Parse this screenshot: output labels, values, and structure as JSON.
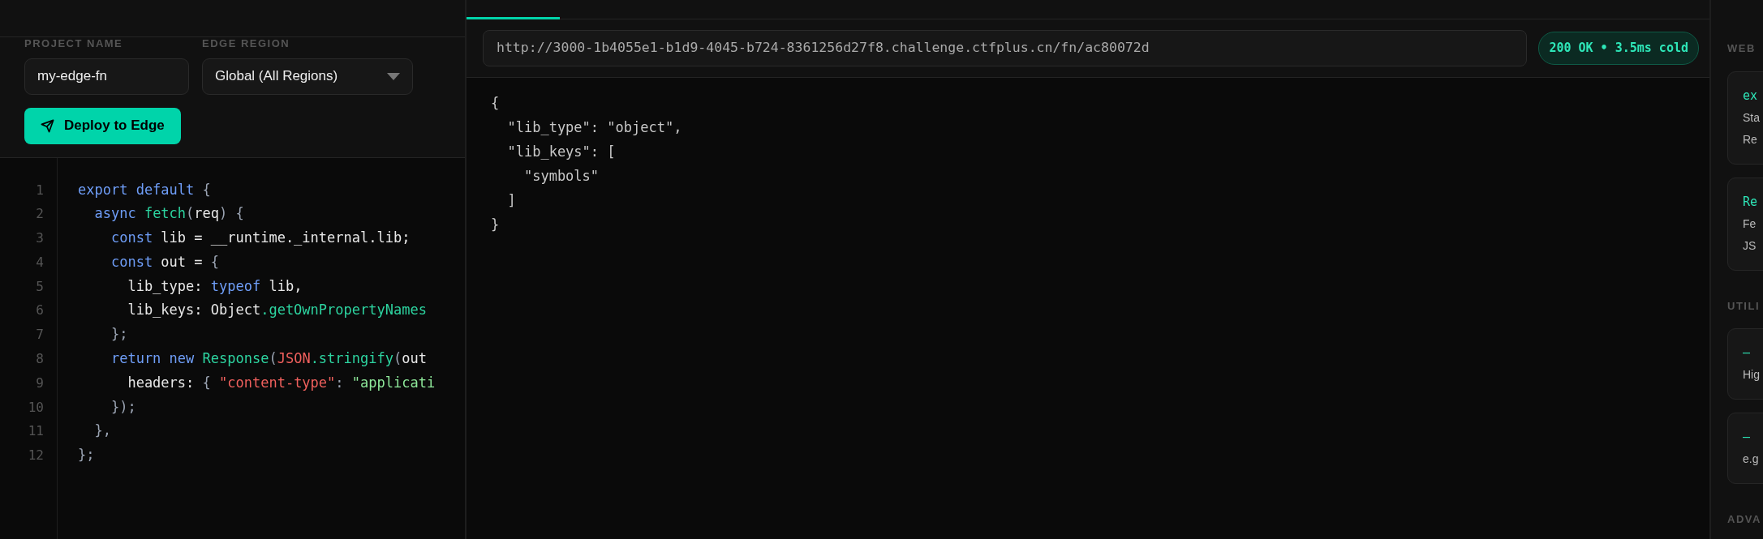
{
  "form": {
    "project_name": {
      "label": "PROJECT NAME",
      "value": "my-edge-fn"
    },
    "edge_region": {
      "label": "EDGE REGION",
      "value": "Global (All Regions)"
    },
    "deploy_button": "Deploy to Edge"
  },
  "code_lines": [
    {
      "number": "1",
      "tokens": [
        {
          "text": "export default",
          "kind": "keyword"
        },
        {
          "text": " {",
          "kind": "punct"
        }
      ]
    },
    {
      "number": "2",
      "tokens": [
        {
          "text": "  async",
          "kind": "keyword"
        },
        {
          "text": " fetch",
          "kind": "function"
        },
        {
          "text": "(",
          "kind": "punct"
        },
        {
          "text": "req",
          "kind": "plain"
        },
        {
          "text": ") {",
          "kind": "punct"
        }
      ]
    },
    {
      "number": "3",
      "tokens": [
        {
          "text": "    const",
          "kind": "keyword"
        },
        {
          "text": " lib = __runtime._internal.lib;",
          "kind": "plain"
        }
      ]
    },
    {
      "number": "4",
      "tokens": [
        {
          "text": "    const",
          "kind": "keyword"
        },
        {
          "text": " out = ",
          "kind": "plain"
        },
        {
          "text": "{",
          "kind": "punct"
        }
      ]
    },
    {
      "number": "5",
      "tokens": [
        {
          "text": "      lib_type: ",
          "kind": "plain"
        },
        {
          "text": "typeof",
          "kind": "keyword"
        },
        {
          "text": " lib,",
          "kind": "plain"
        }
      ]
    },
    {
      "number": "6",
      "tokens": [
        {
          "text": "      lib_keys: Object",
          "kind": "plain"
        },
        {
          "text": ".getOwnPropertyNames",
          "kind": "function"
        }
      ]
    },
    {
      "number": "7",
      "tokens": [
        {
          "text": "    };",
          "kind": "punct"
        }
      ]
    },
    {
      "number": "8",
      "tokens": [
        {
          "text": "    return new",
          "kind": "keyword"
        },
        {
          "text": " Response",
          "kind": "function"
        },
        {
          "text": "(",
          "kind": "punct"
        },
        {
          "text": "JSON",
          "kind": "string"
        },
        {
          "text": ".stringify",
          "kind": "function"
        },
        {
          "text": "(",
          "kind": "punct"
        },
        {
          "text": "out",
          "kind": "plain"
        }
      ]
    },
    {
      "number": "9",
      "tokens": [
        {
          "text": "      headers: ",
          "kind": "plain"
        },
        {
          "text": "{ ",
          "kind": "punct"
        },
        {
          "text": "\"content-type\"",
          "kind": "string"
        },
        {
          "text": ": ",
          "kind": "punct"
        },
        {
          "text": "\"applicati",
          "kind": "value"
        }
      ]
    },
    {
      "number": "10",
      "tokens": [
        {
          "text": "    });",
          "kind": "punct"
        }
      ]
    },
    {
      "number": "11",
      "tokens": [
        {
          "text": "  },",
          "kind": "punct"
        }
      ]
    },
    {
      "number": "12",
      "tokens": [
        {
          "text": "};",
          "kind": "punct"
        }
      ]
    }
  ],
  "request": {
    "url": "http://3000-1b4055e1-b1d9-4045-b724-8361256d27f8.challenge.ctfplus.cn/fn/ac80072d",
    "status": "200 OK • 3.5ms cold"
  },
  "response_lines": [
    "{",
    "  \"lib_type\": \"object\",",
    "  \"lib_keys\": [",
    "    \"symbols\"",
    "  ]",
    "}"
  ],
  "sidebar": {
    "sections": [
      {
        "title": "WEB",
        "cards": [
          {
            "name": "ex",
            "lines": [
              "Sta",
              "Re"
            ]
          },
          {
            "name": "Re",
            "lines": [
              "Fe",
              "JS"
            ]
          }
        ]
      },
      {
        "title": "UTILI",
        "cards": [
          {
            "name": "—",
            "lines": [
              "Hig"
            ]
          },
          {
            "name": "—",
            "lines": [
              "e.g"
            ]
          }
        ]
      },
      {
        "title": "ADVA"
      }
    ]
  }
}
